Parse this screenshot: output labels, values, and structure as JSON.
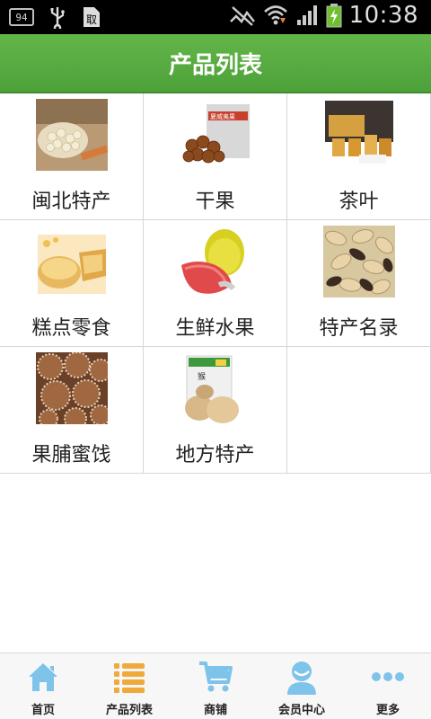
{
  "status_bar": {
    "badge_text": "94",
    "time": "10:38",
    "icons": [
      "notification-badge-icon",
      "usb-icon",
      "sim-icon",
      "no-signal-icon",
      "wifi-icon",
      "signal-icon",
      "battery-charging-icon"
    ]
  },
  "header": {
    "title": "产品列表"
  },
  "products": [
    {
      "label": "闽北特产",
      "icon": "lotus-seeds-image"
    },
    {
      "label": "干果",
      "icon": "macadamia-nuts-image"
    },
    {
      "label": "茶叶",
      "icon": "tea-gift-box-image"
    },
    {
      "label": "糕点零食",
      "icon": "pastry-cakes-image"
    },
    {
      "label": "生鲜水果",
      "icon": "pomelo-fruit-image"
    },
    {
      "label": "特产名录",
      "icon": "peanuts-image"
    },
    {
      "label": "果脯蜜饯",
      "icon": "dried-fruit-image"
    },
    {
      "label": "地方特产",
      "icon": "mushroom-pack-image"
    }
  ],
  "bottom_nav": [
    {
      "label": "首页",
      "icon": "home-icon",
      "color": "#7ec3ea"
    },
    {
      "label": "产品列表",
      "icon": "list-icon",
      "color": "#f0a93b"
    },
    {
      "label": "商铺",
      "icon": "cart-icon",
      "color": "#7ec3ea"
    },
    {
      "label": "会员中心",
      "icon": "user-icon",
      "color": "#7ec3ea"
    },
    {
      "label": "更多",
      "icon": "more-icon",
      "color": "#7ec3ea"
    }
  ],
  "colors": {
    "header_green": "#56a83f",
    "nav_blue": "#7ec3ea",
    "nav_orange": "#f0a93b"
  }
}
